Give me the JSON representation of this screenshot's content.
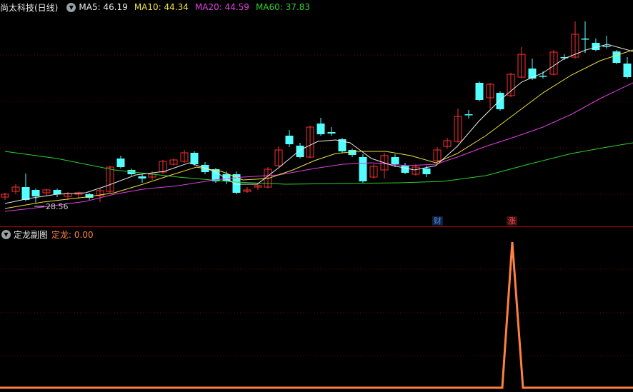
{
  "main_chart": {
    "title": "尚太科技(日线)",
    "indicators": [
      {
        "label": "MA5:",
        "value": "46.19",
        "color": "#e8e8e8"
      },
      {
        "label": "MA10:",
        "value": "44.34",
        "color": "#f0e040"
      },
      {
        "label": "MA20:",
        "value": "44.59",
        "color": "#e040e0"
      },
      {
        "label": "MA60:",
        "value": "37.83",
        "color": "#30d030"
      }
    ],
    "low_marker": "28.56",
    "badges": [
      {
        "text": "财",
        "color": "#4a90e2",
        "bg": "#102040"
      },
      {
        "text": "涨",
        "color": "#ff5050",
        "bg": "#401010"
      }
    ]
  },
  "sub_chart": {
    "title": "定龙副图",
    "indicator_label": "定龙:",
    "indicator_value": "0.00",
    "color": "#ff8040"
  },
  "colors": {
    "up": "#ff3030",
    "down": "#54ffff",
    "grid": "#7a0000",
    "ma5": "#e8e8e8",
    "ma10": "#f0e040",
    "ma20": "#e040e0",
    "ma60": "#30d030",
    "signal": "#ff8040"
  }
}
